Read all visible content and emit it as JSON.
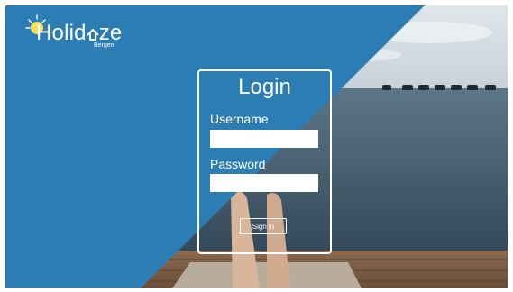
{
  "brand": {
    "name_prefix": "Holid",
    "name_suffix": "ze",
    "subtitle": "Bergen",
    "logo_sun_color": "#f4e15a"
  },
  "login": {
    "title": "Login",
    "username_label": "Username",
    "username_value": "",
    "password_label": "Password",
    "password_value": "",
    "signin_label": "Sign in"
  },
  "colors": {
    "panel_blue": "#2b7db3",
    "text": "#ffffff"
  }
}
